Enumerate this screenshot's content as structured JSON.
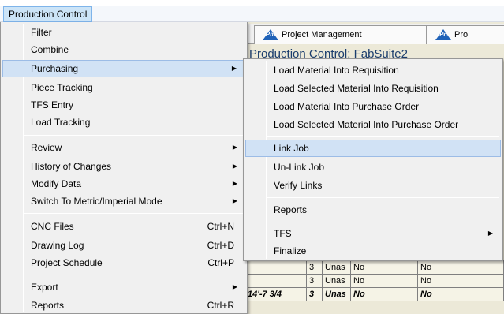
{
  "menubar": {
    "item": "Production Control"
  },
  "tabs": [
    {
      "logo": "Pm",
      "label": "Project Management"
    },
    {
      "logo": "Pc",
      "label": "Pro"
    }
  ],
  "app_title": "Production Control: FabSuite2",
  "grid": {
    "rows": [
      [
        "",
        "3",
        "Unas",
        "No",
        "No"
      ],
      [
        "",
        "3",
        "Unas",
        "No",
        "No"
      ],
      [
        "14'-7 3/4",
        "3",
        "Unas",
        "No",
        "No"
      ]
    ]
  },
  "main_menu": {
    "items": [
      {
        "label": "Filter"
      },
      {
        "label": "Combine"
      },
      {
        "label": "Purchasing",
        "submenu": true
      },
      {
        "label": "Piece Tracking"
      },
      {
        "label": "TFS Entry"
      },
      {
        "label": "Load Tracking"
      },
      {
        "label": "Review",
        "submenu": true
      },
      {
        "label": "History of Changes",
        "submenu": true
      },
      {
        "label": "Modify Data",
        "submenu": true
      },
      {
        "label": "Switch To Metric/Imperial Mode",
        "submenu": true
      },
      {
        "label": "CNC Files",
        "shortcut": "Ctrl+N"
      },
      {
        "label": "Drawing Log",
        "shortcut": "Ctrl+D"
      },
      {
        "label": "Project Schedule",
        "shortcut": "Ctrl+P"
      },
      {
        "label": "Export",
        "submenu": true
      },
      {
        "label": "Reports",
        "shortcut": "Ctrl+R"
      }
    ]
  },
  "purchasing_menu": {
    "items": [
      {
        "label": "Load Material Into Requisition"
      },
      {
        "label": "Load Selected Material Into Requisition"
      },
      {
        "label": "Load Material Into Purchase Order"
      },
      {
        "label": "Load Selected Material Into Purchase Order"
      },
      {
        "label": "Link Job"
      },
      {
        "label": "Un-Link Job"
      },
      {
        "label": "Verify Links"
      },
      {
        "label": "Reports"
      },
      {
        "label": "TFS",
        "submenu": true
      },
      {
        "label": "Finalize"
      }
    ]
  },
  "icons": {
    "submenu_arrow": "triangle-right-icon"
  },
  "colors": {
    "highlight": "#d1e2f5",
    "menubar_active": "#cce4f7",
    "title": "#1b3d6d"
  }
}
